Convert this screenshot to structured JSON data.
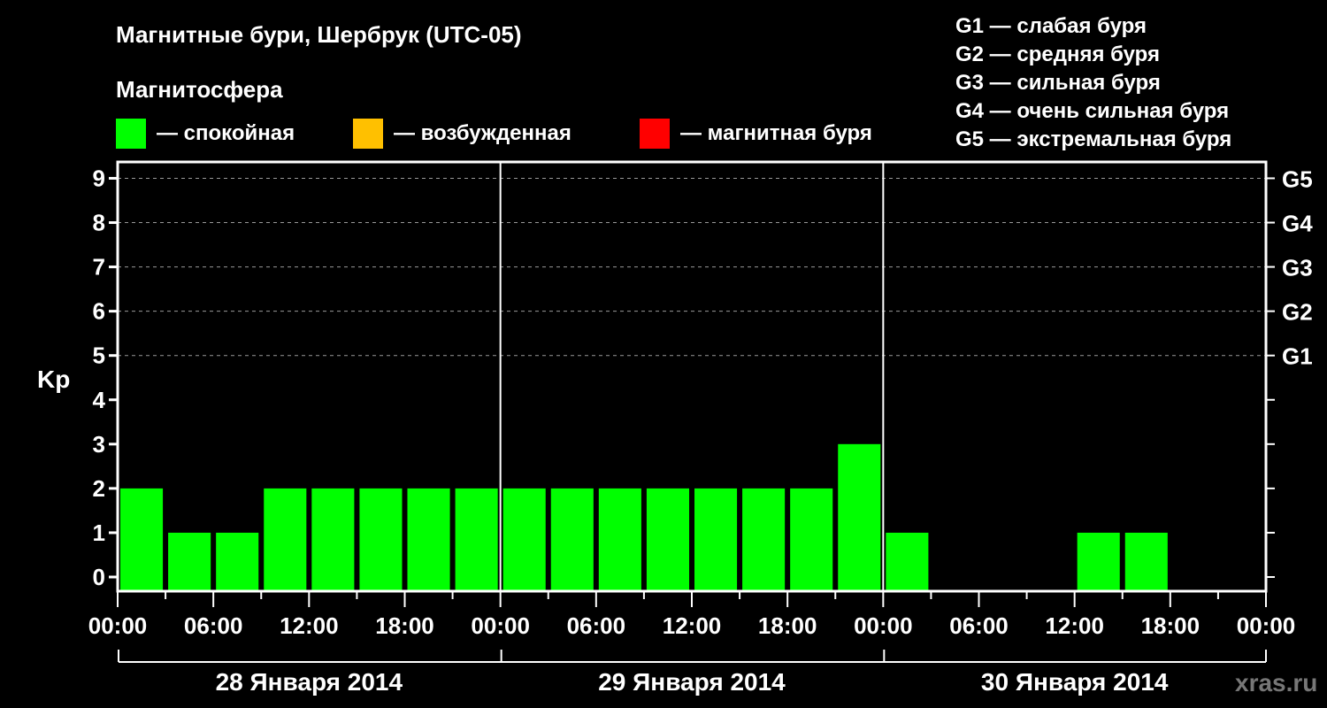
{
  "title": "Магнитные бури, Шербрук (UTC-05)",
  "subtitle": "Магнитосфера",
  "legend": [
    {
      "label": "— спокойная",
      "color": "#00ff00"
    },
    {
      "label": "— возбужденная",
      "color": "#ffc000"
    },
    {
      "label": "— магнитная буря",
      "color": "#ff0000"
    }
  ],
  "g_scale": [
    "G1 — слабая буря",
    "G2 — средняя буря",
    "G3 — сильная буря",
    "G4 — очень сильная буря",
    "G5 — экстремальная буря"
  ],
  "watermark": "xras.ru",
  "chart_data": {
    "type": "bar",
    "ylabel": "Kp",
    "ylim": [
      0,
      9
    ],
    "yticks": [
      "0",
      "1",
      "2",
      "3",
      "4",
      "5",
      "6",
      "7",
      "8",
      "9"
    ],
    "right_ticks": [
      {
        "kp": 5,
        "label": "G1"
      },
      {
        "kp": 6,
        "label": "G2"
      },
      {
        "kp": 7,
        "label": "G3"
      },
      {
        "kp": 8,
        "label": "G4"
      },
      {
        "kp": 9,
        "label": "G5"
      }
    ],
    "xticks": [
      "00:00",
      "06:00",
      "12:00",
      "18:00",
      "00:00",
      "06:00",
      "12:00",
      "18:00",
      "00:00",
      "06:00",
      "12:00",
      "18:00",
      "00:00"
    ],
    "days": [
      "28 Января 2014",
      "29 Января 2014",
      "30 Января 2014"
    ],
    "interval_hours": 3,
    "values": [
      2,
      1,
      1,
      2,
      2,
      2,
      2,
      2,
      2,
      2,
      2,
      2,
      2,
      2,
      2,
      3,
      1,
      null,
      null,
      null,
      1,
      1,
      null,
      null
    ],
    "bar_color": "#00ff00",
    "grid": true
  }
}
